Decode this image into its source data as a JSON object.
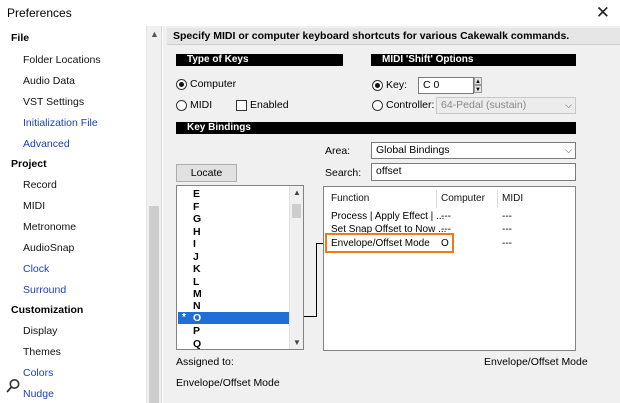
{
  "window": {
    "title": "Preferences",
    "close": "✕"
  },
  "sidebar": {
    "groups": [
      {
        "category": "File",
        "items": [
          {
            "label": "Folder Locations",
            "color": "#111111"
          },
          {
            "label": "Audio Data",
            "color": "#111111"
          },
          {
            "label": "VST Settings",
            "color": "#111111"
          },
          {
            "label": "Initialization File",
            "color": "#1a3fb5"
          },
          {
            "label": "Advanced",
            "color": "#1a3fb5"
          }
        ]
      },
      {
        "category": "Project",
        "items": [
          {
            "label": "Record",
            "color": "#111111"
          },
          {
            "label": "MIDI",
            "color": "#111111"
          },
          {
            "label": "Metronome",
            "color": "#111111"
          },
          {
            "label": "AudioSnap",
            "color": "#111111"
          },
          {
            "label": "Clock",
            "color": "#1a3fb5"
          },
          {
            "label": "Surround",
            "color": "#1a3fb5"
          }
        ]
      },
      {
        "category": "Customization",
        "items": [
          {
            "label": "Display",
            "color": "#111111"
          },
          {
            "label": "Themes",
            "color": "#111111"
          },
          {
            "label": "Colors",
            "color": "#1a3fb5"
          },
          {
            "label": "Nudge",
            "color": "#1a3fb5"
          }
        ]
      }
    ]
  },
  "header": {
    "text": "Specify MIDI or computer keyboard shortcuts for various Cakewalk commands."
  },
  "type_of_keys": {
    "heading": "Type of Keys",
    "computer_label": "Computer",
    "midi_label": "MIDI",
    "enabled_label": "Enabled",
    "selected": "Computer"
  },
  "midi_shift": {
    "heading": "MIDI 'Shift' Options",
    "key_label": "Key:",
    "key_value": "C 0",
    "controller_label": "Controller:",
    "controller_value": "64-Pedal (sustain)"
  },
  "key_bindings": {
    "heading": "Key Bindings",
    "locate_button": "Locate Key...",
    "area_label": "Area:",
    "area_value": "Global Bindings",
    "search_label": "Search:",
    "search_value": "offset",
    "keys": [
      "E",
      "F",
      "G",
      "H",
      "I",
      "J",
      "K",
      "L",
      "M",
      "N"
    ],
    "selected_key": "O",
    "selected_marker": "*",
    "keys_after": [
      "P",
      "Q"
    ],
    "columns": [
      "Function",
      "Computer",
      "MIDI"
    ],
    "rows": [
      {
        "function": "Process | Apply Effect | ...",
        "computer": "---",
        "midi": "---"
      },
      {
        "function": "Set Snap Offset to Now ...",
        "computer": "---",
        "midi": "---"
      },
      {
        "function": "Envelope/Offset Mode",
        "computer": "O",
        "midi": "---"
      }
    ],
    "assigned_label": "Assigned to:",
    "assigned_function_right": "Envelope/Offset Mode",
    "assigned_function_bottom": "Envelope/Offset Mode",
    "highlight_color": "#f07a17"
  }
}
